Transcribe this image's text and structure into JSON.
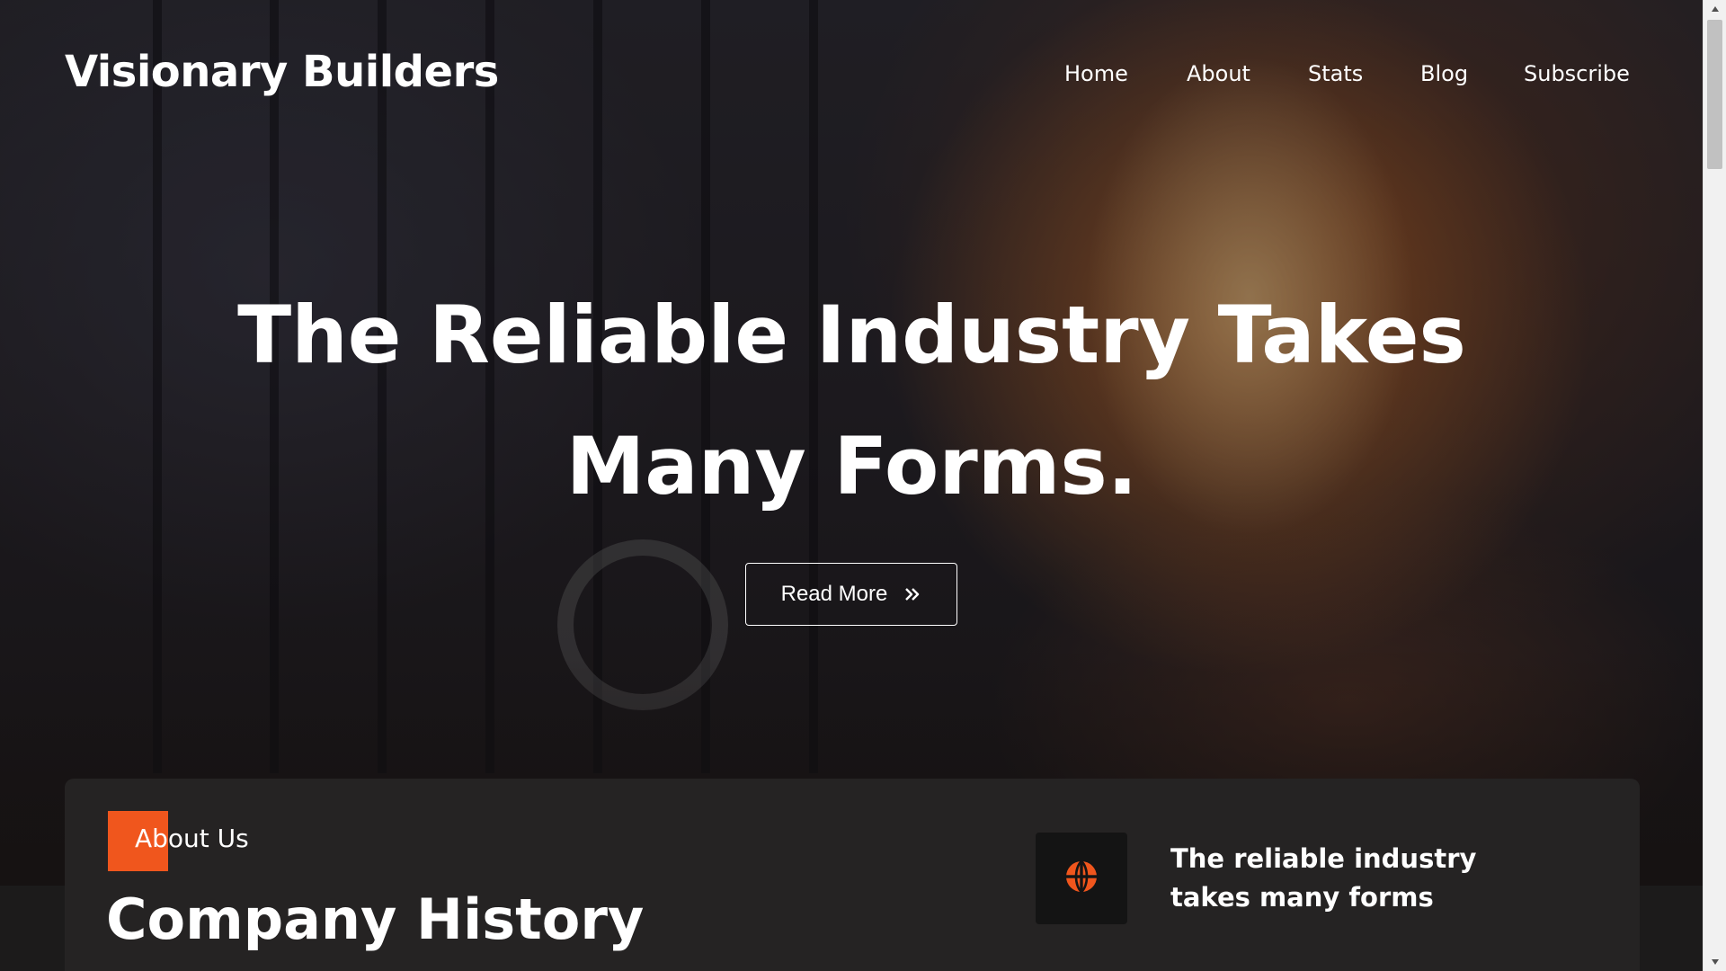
{
  "header": {
    "brand": "Visionary Builders",
    "nav": [
      "Home",
      "About",
      "Stats",
      "Blog",
      "Subscribe"
    ]
  },
  "hero": {
    "headline_line1": "The Reliable Industry Takes",
    "headline_line2": "Many Forms.",
    "cta_label": "Read More"
  },
  "about": {
    "label": "About Us",
    "title": "Company History",
    "feature_icon": "globe-icon",
    "feature_text": "The reliable industry takes many forms"
  },
  "colors": {
    "accent": "#f0561d",
    "card": "#252323",
    "icon_box": "#141414"
  }
}
